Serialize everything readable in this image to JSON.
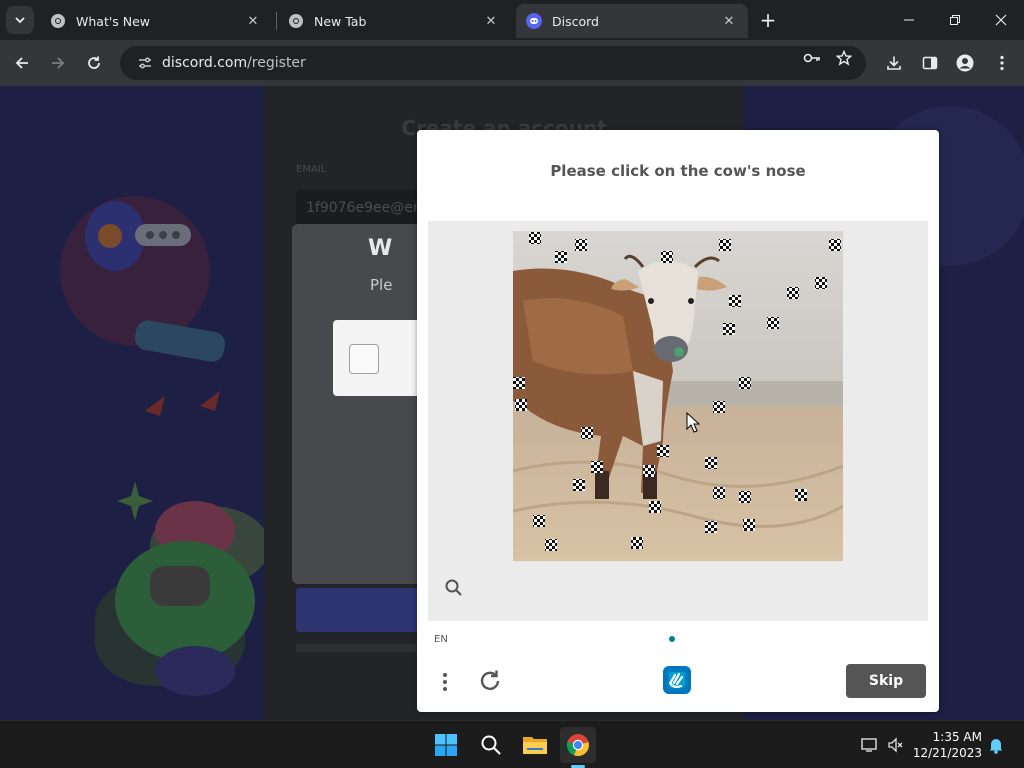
{
  "browser": {
    "tabs": [
      {
        "title": "What's New",
        "active": false
      },
      {
        "title": "New Tab",
        "active": false
      },
      {
        "title": "Discord",
        "active": true
      }
    ],
    "url_host": "discord.com",
    "url_path": "/register"
  },
  "page": {
    "title": "Create an account",
    "email_label": "EMAIL",
    "email_value": "1f9076e9ee@em",
    "verify_heading": "W",
    "verify_sub": "Ple"
  },
  "captcha": {
    "prompt": "Please click on the cow's nose",
    "language": "EN",
    "skip_label": "Skip",
    "accent_color": "#00838f"
  },
  "taskbar": {
    "apps": [
      "start",
      "search",
      "file-explorer",
      "chrome"
    ],
    "time": "1:35 AM",
    "date": "12/21/2023"
  }
}
